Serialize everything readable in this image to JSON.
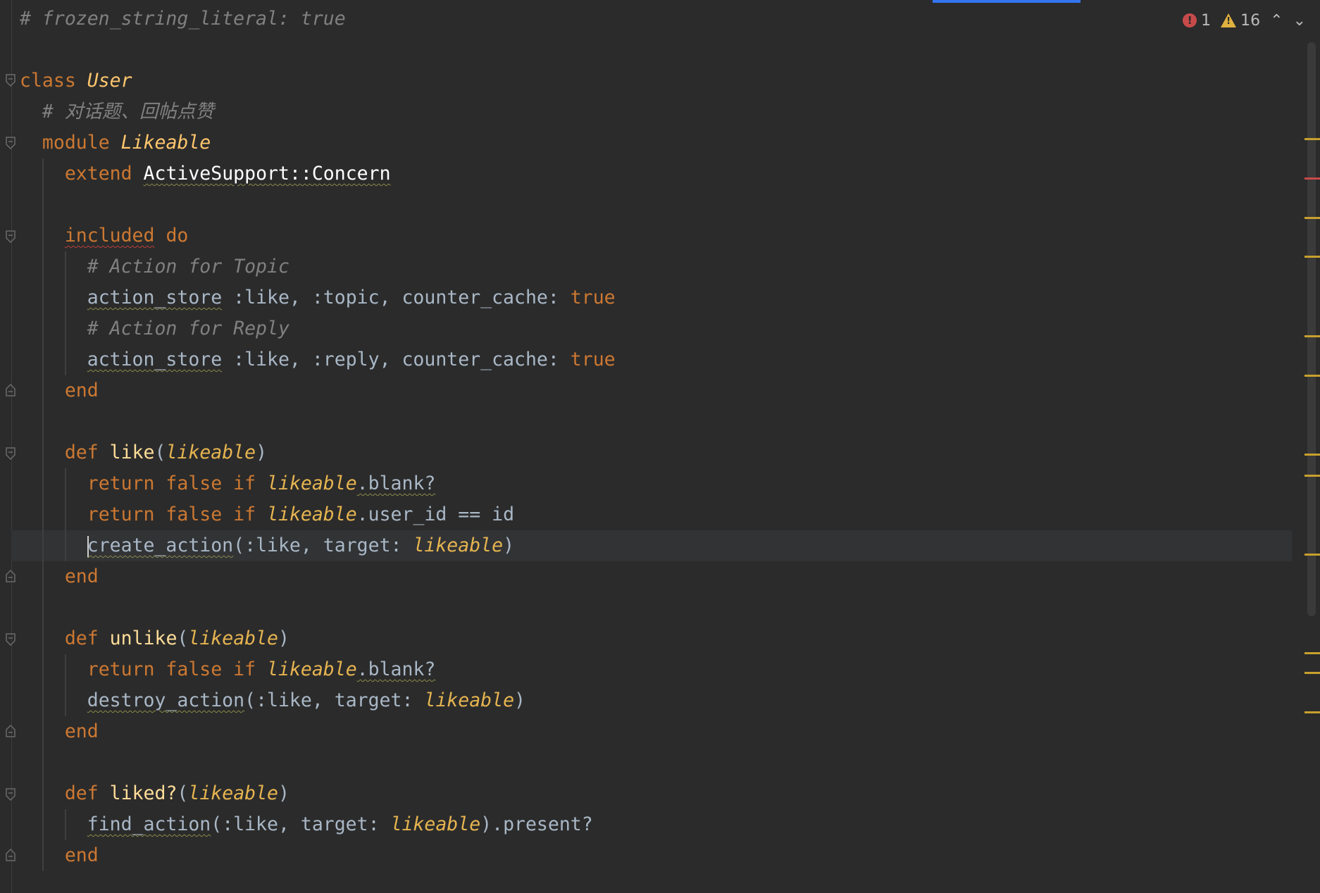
{
  "status": {
    "errors": "1",
    "warnings": "16",
    "prev_icon": "chevron-up-icon",
    "next_icon": "chevron-down-icon"
  },
  "colors": {
    "background": "#2b2b2b",
    "keyword": "#cc7832",
    "comment": "#808080",
    "class_name": "#ffc66d",
    "param": "#e6b450",
    "text": "#a9b7c6",
    "error_marker": "#c74a4a",
    "warning_marker": "#e0b13f",
    "tab_accent": "#3574f0"
  },
  "code": {
    "l1": "# frozen_string_literal: true",
    "l3_kw": "class",
    "l3_name": "User",
    "l4": "# 对话题、回帖点赞",
    "l5_kw": "module",
    "l5_name": "Likeable",
    "l6_kw": "extend",
    "l6_const": "ActiveSupport::Concern",
    "l8_kw": "included",
    "l8_do": "do",
    "l9": "# Action for Topic",
    "l10_fn": "action_store",
    "l10_args": ":like, :topic, counter_cache: ",
    "l10_true": "true",
    "l11": "# Action for Reply",
    "l12_fn": "action_store",
    "l12_args": ":like, :reply, counter_cache: ",
    "l12_true": "true",
    "l13": "end",
    "l15_def": "def",
    "l15_name": "like",
    "l15_open": "(",
    "l15_param": "likeable",
    "l15_close": ")",
    "l16_ret": "return false if",
    "l16_param": "likeable",
    "l16_rest": ".blank?",
    "l17_ret": "return false if",
    "l17_param": "likeable",
    "l17_rest": ".user_id == id",
    "l18_fn": "create_action",
    "l18_args": "(:like, target: ",
    "l18_param": "likeable",
    "l18_close": ")",
    "l19": "end",
    "l21_def": "def",
    "l21_name": "unlike",
    "l21_open": "(",
    "l21_param": "likeable",
    "l21_close": ")",
    "l22_ret": "return false if",
    "l22_param": "likeable",
    "l22_rest": ".blank?",
    "l23_fn": "destroy_action",
    "l23_args": "(:like, target: ",
    "l23_param": "likeable",
    "l23_close": ")",
    "l24": "end",
    "l26_def": "def",
    "l26_name": "liked?",
    "l26_open": "(",
    "l26_param": "likeable",
    "l26_close": ")",
    "l27_fn": "find_action",
    "l27_args": "(:like, target: ",
    "l27_param": "likeable",
    "l27_close": ").present?",
    "l28": "end"
  }
}
